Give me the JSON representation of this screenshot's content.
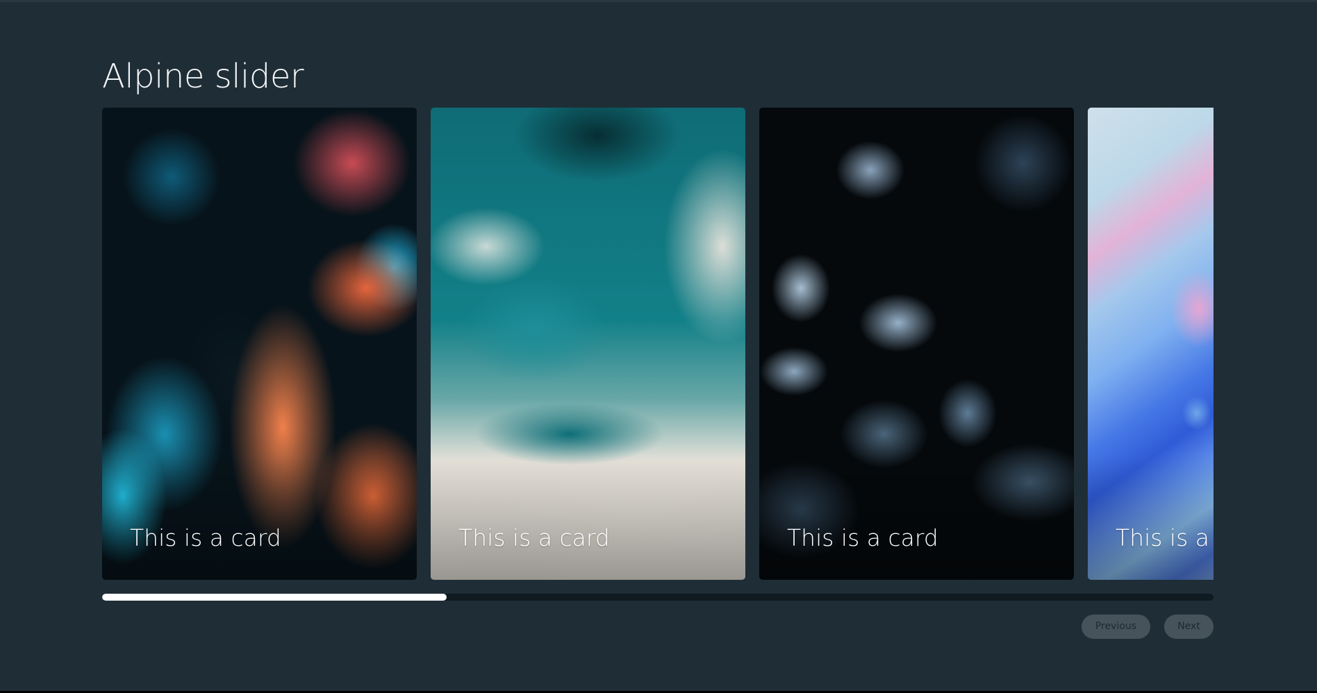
{
  "page": {
    "title": "Alpine slider"
  },
  "slider": {
    "cards": [
      {
        "caption": "This is a card",
        "artwork": "abstract fluid art, orange and cyan on black"
      },
      {
        "caption": "This is a card",
        "artwork": "abstract fluid art, teal and cream swirls"
      },
      {
        "caption": "This is a card",
        "artwork": "abstract fluid art, pale blue on black"
      },
      {
        "caption": "This is a card",
        "artwork": "abstract fluid art, blue, pink and white"
      }
    ],
    "progress_fraction": 0.31
  },
  "controls": {
    "previous_label": "Previous",
    "next_label": "Next"
  },
  "colors": {
    "background": "#1f2d36",
    "progress_track": "#0f1a21",
    "progress_fill": "#ffffff",
    "button_background": "#47535b",
    "button_text": "#1d2a32"
  }
}
